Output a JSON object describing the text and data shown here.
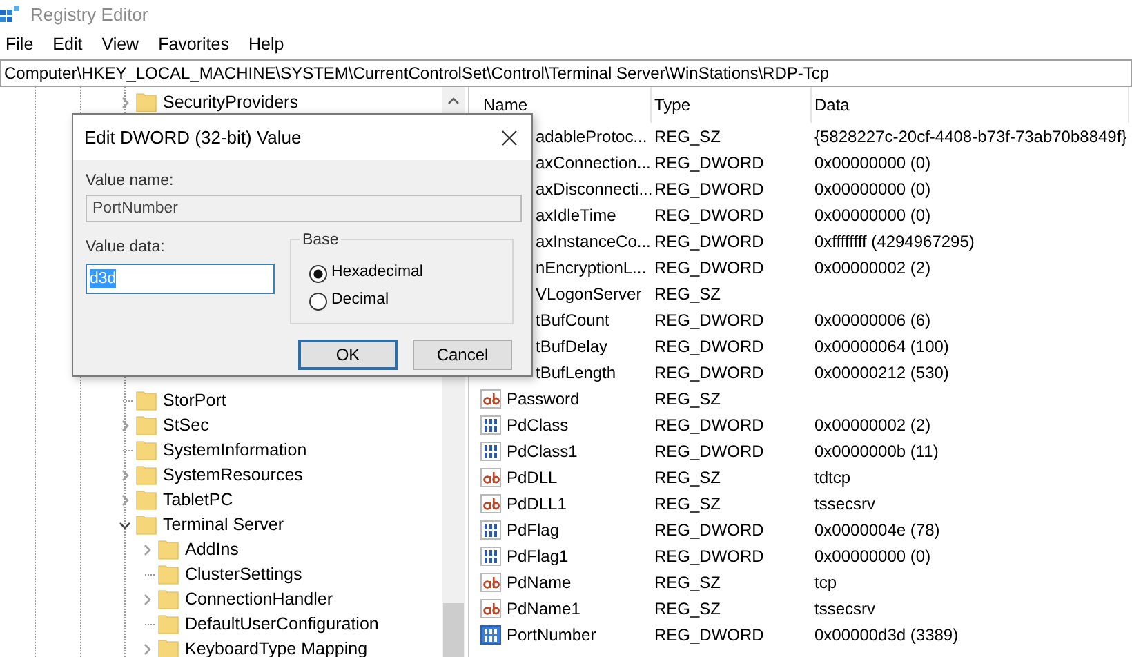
{
  "window": {
    "title": "Registry Editor"
  },
  "menu": [
    "File",
    "Edit",
    "View",
    "Favorites",
    "Help"
  ],
  "address": "Computer\\HKEY_LOCAL_MACHINE\\SYSTEM\\CurrentControlSet\\Control\\Terminal Server\\WinStations\\RDP-Tcp",
  "tree": {
    "items": [
      {
        "label": "SecurityProviders",
        "expandable": true,
        "expanded": false
      },
      {
        "label": "StorPort",
        "expandable": false
      },
      {
        "label": "StSec",
        "expandable": true,
        "expanded": false
      },
      {
        "label": "SystemInformation",
        "expandable": false
      },
      {
        "label": "SystemResources",
        "expandable": true,
        "expanded": false
      },
      {
        "label": "TabletPC",
        "expandable": true,
        "expanded": false
      },
      {
        "label": "Terminal Server",
        "expandable": true,
        "expanded": true,
        "children": [
          {
            "label": "AddIns",
            "expandable": true,
            "expanded": false
          },
          {
            "label": "ClusterSettings",
            "expandable": false
          },
          {
            "label": "ConnectionHandler",
            "expandable": true,
            "expanded": false
          },
          {
            "label": "DefaultUserConfiguration",
            "expandable": false
          },
          {
            "label": "KeyboardType Mapping",
            "expandable": true,
            "expanded": false
          }
        ]
      }
    ]
  },
  "table": {
    "columns": [
      "Name",
      "Type",
      "Data"
    ],
    "rows": [
      {
        "name": "adableProtoc...",
        "type": "REG_SZ",
        "data": "{5828227c-20cf-4408-b73f-73ab70b8849f}",
        "covered": true
      },
      {
        "name": "axConnection...",
        "type": "REG_DWORD",
        "data": "0x00000000 (0)",
        "covered": true
      },
      {
        "name": "axDisconnecti...",
        "type": "REG_DWORD",
        "data": "0x00000000 (0)",
        "covered": true
      },
      {
        "name": "axIdleTime",
        "type": "REG_DWORD",
        "data": "0x00000000 (0)",
        "covered": true
      },
      {
        "name": "axInstanceCo...",
        "type": "REG_DWORD",
        "data": "0xffffffff (4294967295)",
        "covered": true
      },
      {
        "name": "nEncryptionL...",
        "type": "REG_DWORD",
        "data": "0x00000002 (2)",
        "covered": true
      },
      {
        "name": "VLogonServer",
        "type": "REG_SZ",
        "covered": true
      },
      {
        "name": "tBufCount",
        "type": "REG_DWORD",
        "data": "0x00000006 (6)",
        "covered": true
      },
      {
        "name": "tBufDelay",
        "type": "REG_DWORD",
        "data": "0x00000064 (100)",
        "covered": true
      },
      {
        "name": "tBufLength",
        "type": "REG_DWORD",
        "data": "0x00000212 (530)",
        "covered": true
      },
      {
        "name": "Password",
        "type": "REG_SZ",
        "covered": false,
        "selected": false
      },
      {
        "name": "PdClass",
        "type": "REG_DWORD",
        "data": "0x00000002 (2)",
        "covered": false,
        "selected": false
      },
      {
        "name": "PdClass1",
        "type": "REG_DWORD",
        "data": "0x0000000b (11)",
        "covered": false,
        "selected": false
      },
      {
        "name": "PdDLL",
        "type": "REG_SZ",
        "data": "tdtcp",
        "covered": false,
        "selected": false
      },
      {
        "name": "PdDLL1",
        "type": "REG_SZ",
        "data": "tssecsrv",
        "covered": false,
        "selected": false
      },
      {
        "name": "PdFlag",
        "type": "REG_DWORD",
        "data": "0x0000004e (78)",
        "covered": false,
        "selected": false
      },
      {
        "name": "PdFlag1",
        "type": "REG_DWORD",
        "data": "0x00000000 (0)",
        "covered": false,
        "selected": false
      },
      {
        "name": "PdName",
        "type": "REG_SZ",
        "data": "tcp",
        "covered": false,
        "selected": false
      },
      {
        "name": "PdName1",
        "type": "REG_SZ",
        "data": "tssecsrv",
        "covered": false,
        "selected": false
      },
      {
        "name": "PortNumber",
        "type": "REG_DWORD",
        "data": "0x00000d3d (3389)",
        "covered": false,
        "selected": true
      }
    ]
  },
  "dialog": {
    "title": "Edit DWORD (32-bit) Value",
    "value_name_label": "Value name:",
    "value_name": "PortNumber",
    "value_data_label": "Value data:",
    "value_data": "d3d",
    "value_data_selected": true,
    "base": {
      "label": "Base",
      "options": [
        {
          "label": "Hexadecimal",
          "selected": true
        },
        {
          "label": "Decimal",
          "selected": false
        }
      ]
    },
    "buttons": [
      {
        "label": "OK",
        "default": true
      },
      {
        "label": "Cancel",
        "default": false
      }
    ]
  }
}
